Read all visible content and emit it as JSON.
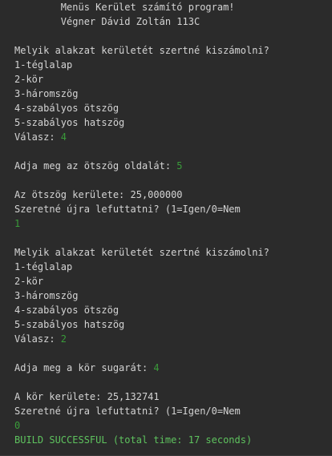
{
  "colors": {
    "background": "#2b2b2b",
    "output_text": "#d4d4d4",
    "user_input": "#3a9c3a",
    "build_success": "#5ec25e"
  },
  "header": {
    "title": "        Menüs Kerület számító program!",
    "author": "        Végner Dávid Zoltán 113C"
  },
  "run1": {
    "question": "Melyik alakzat kerületét szertné kiszámolni?",
    "options": [
      "1-téglalap",
      "2-kör",
      "3-háromszög",
      "4-szabályos ötszög",
      "5-szabályos hatszög"
    ],
    "answer_prompt": "Válasz: ",
    "answer_value": "4",
    "side_prompt": "Adja meg az ötszög oldalát: ",
    "side_value": "5",
    "result": "Az ötszög kerülete: 25,000000",
    "rerun_prompt": "Szeretné újra lefuttatni? (1=Igen/0=Nem",
    "rerun_value": "1"
  },
  "run2": {
    "question": "Melyik alakzat kerületét szertné kiszámolni?",
    "options": [
      "1-téglalap",
      "2-kör",
      "3-háromszög",
      "4-szabályos ötszög",
      "5-szabályos hatszög"
    ],
    "answer_prompt": "Válasz: ",
    "answer_value": "2",
    "radius_prompt": "Adja meg a kör sugarát: ",
    "radius_value": "4",
    "result": "A kör kerülete: 25,132741",
    "rerun_prompt": "Szeretné újra lefuttatni? (1=Igen/0=Nem",
    "rerun_value": "0"
  },
  "build_status": "BUILD SUCCESSFUL (total time: 17 seconds)"
}
